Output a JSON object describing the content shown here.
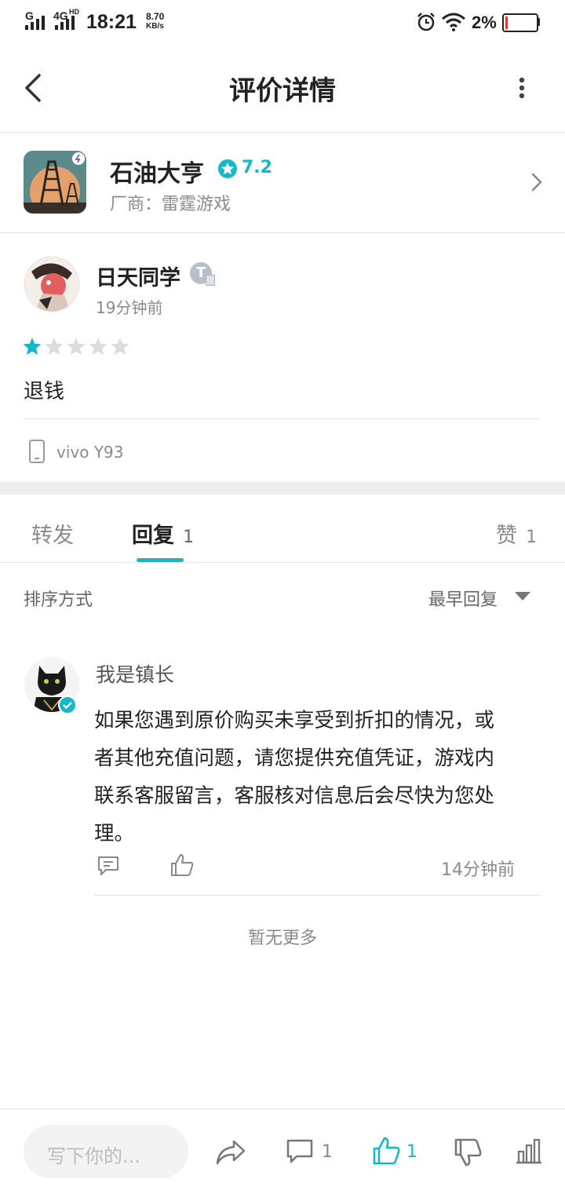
{
  "status_bar": {
    "signal1": "G",
    "signal2": "4G",
    "signal2_sup": "HD",
    "time": "18:21",
    "speed_value": "8.70",
    "speed_unit": "KB/s",
    "battery": "2%"
  },
  "header": {
    "title": "评价详情"
  },
  "game": {
    "name": "石油大亨",
    "score": "7.2",
    "vendor": "厂商：雷霆游戏"
  },
  "review": {
    "author": "日天同学",
    "badge": "T",
    "time": "19分钟前",
    "stars": 1,
    "stars_total": 5,
    "text": "退钱",
    "device": "vivo Y93"
  },
  "tabs": {
    "forward": "转发",
    "reply": "回复",
    "reply_count": "1",
    "like": "赞",
    "like_count": "1"
  },
  "sort": {
    "label": "排序方式",
    "value": "最早回复"
  },
  "reply": {
    "author": "我是镇长",
    "lines": [
      "如果您遇到原价购买未享受到折扣的情况，或",
      "者其他充值问题，请您提供充值凭证，游戏内",
      "联系客服留言，客服核对信息后会尽快为您处",
      "理。"
    ],
    "time": "14分钟前"
  },
  "no_more": "暂无更多",
  "bottom_bar": {
    "input_placeholder": "写下你的...",
    "comment_count": "1",
    "like_count": "1"
  },
  "colors": {
    "accent": "#14b9c8"
  }
}
